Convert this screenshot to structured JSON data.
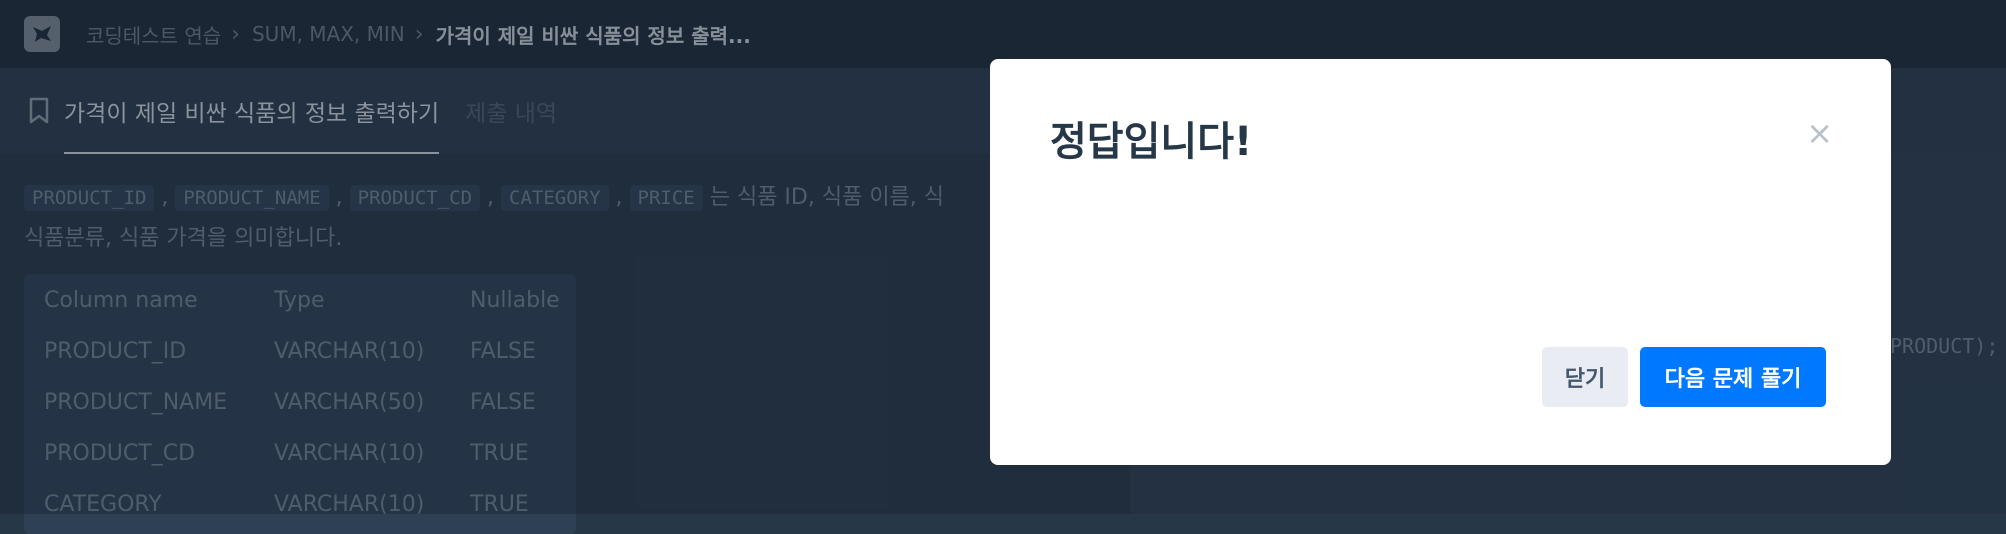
{
  "breadcrumb": {
    "items": [
      "코딩테스트 연습",
      "SUM, MAX, MIN"
    ],
    "current": "가격이 제일 비싼 식품의 정보 출력..."
  },
  "tabs": {
    "title": "가격이 제일 비싼 식품의 정보 출력하기",
    "history": "제출 내역"
  },
  "description": {
    "columns": [
      "PRODUCT_ID",
      "PRODUCT_NAME",
      "PRODUCT_CD",
      "CATEGORY",
      "PRICE"
    ],
    "line1_suffix": "는 식품 ID, 식품 이름, 식",
    "line2": "식품분류, 식품 가격을 의미합니다."
  },
  "table": {
    "headers": [
      "Column name",
      "Type",
      "Nullable"
    ],
    "rows": [
      [
        "PRODUCT_ID",
        "VARCHAR(10)",
        "FALSE"
      ],
      [
        "PRODUCT_NAME",
        "VARCHAR(50)",
        "FALSE"
      ],
      [
        "PRODUCT_CD",
        "VARCHAR(10)",
        "TRUE"
      ],
      [
        "CATEGORY",
        "VARCHAR(10)",
        "TRUE"
      ]
    ]
  },
  "editor": {
    "snippet": "PRODUCT);"
  },
  "modal": {
    "title": "정답입니다!",
    "close_symbol": "×",
    "close_button": "닫기",
    "next_button": "다음 문제 풀기"
  },
  "colors": {
    "background": "#263747",
    "primary": "#0078ff",
    "modal_bg": "#ffffff"
  }
}
